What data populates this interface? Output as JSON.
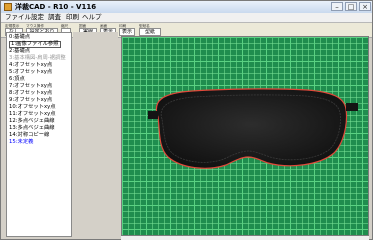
{
  "window": {
    "title": "洋裁CAD - R10 - V116",
    "controls": {
      "minimize": "–",
      "maximize": "□",
      "close": "×"
    }
  },
  "menu": [
    "ファイル",
    "設定",
    "調査",
    "印刷",
    "ヘルプ"
  ],
  "toolbar": {
    "groups": [
      {
        "label": "定規表示",
        "value": "なし"
      },
      {
        "label": "マウス操作",
        "value": "設定どおり"
      },
      {
        "label": "縮尺",
        "value": ""
      },
      {
        "label": "図面",
        "value": "実線"
      },
      {
        "label": "画面",
        "value": "表示"
      },
      {
        "label": "印刷",
        "value": "表示"
      },
      {
        "label": "型紙名",
        "value": "型紙"
      }
    ]
  },
  "sidebar": {
    "items": [
      {
        "text": "0:基礎点",
        "color": "#000000",
        "selected": false
      },
      {
        "text": "1:画像ファイル参照",
        "color": "#000000",
        "selected": true
      },
      {
        "text": "2:基礎点",
        "color": "#000000",
        "selected": false
      },
      {
        "text": "3:基本構図-肩周-裾調整",
        "color": "#9a9a9a",
        "selected": false
      },
      {
        "text": "4:オフセットxy点",
        "color": "#000000",
        "selected": false
      },
      {
        "text": "5:オフセットxy点",
        "color": "#000000",
        "selected": false
      },
      {
        "text": "6:頂点",
        "color": "#000000",
        "selected": false
      },
      {
        "text": "7:オフセットxy点",
        "color": "#000000",
        "selected": false
      },
      {
        "text": "8:オフセットxy点",
        "color": "#000000",
        "selected": false
      },
      {
        "text": "9:オフセットxy点",
        "color": "#000000",
        "selected": false
      },
      {
        "text": "10:オフセットxy点",
        "color": "#000000",
        "selected": false
      },
      {
        "text": "11:オフセットxy点",
        "color": "#000000",
        "selected": false
      },
      {
        "text": "12:多点ベジェ曲線",
        "color": "#000000",
        "selected": false
      },
      {
        "text": "13:多点ベジェ曲線",
        "color": "#000000",
        "selected": false
      },
      {
        "text": "14:対称コピー線",
        "color": "#000000",
        "selected": false
      },
      {
        "text": "15:未定義",
        "color": "#0000ff",
        "selected": false
      }
    ]
  },
  "canvas": {
    "description": "",
    "mat_color": "#1f8d4e",
    "mask_color": "#1b1b1b",
    "outline_color": "#e0493a"
  }
}
